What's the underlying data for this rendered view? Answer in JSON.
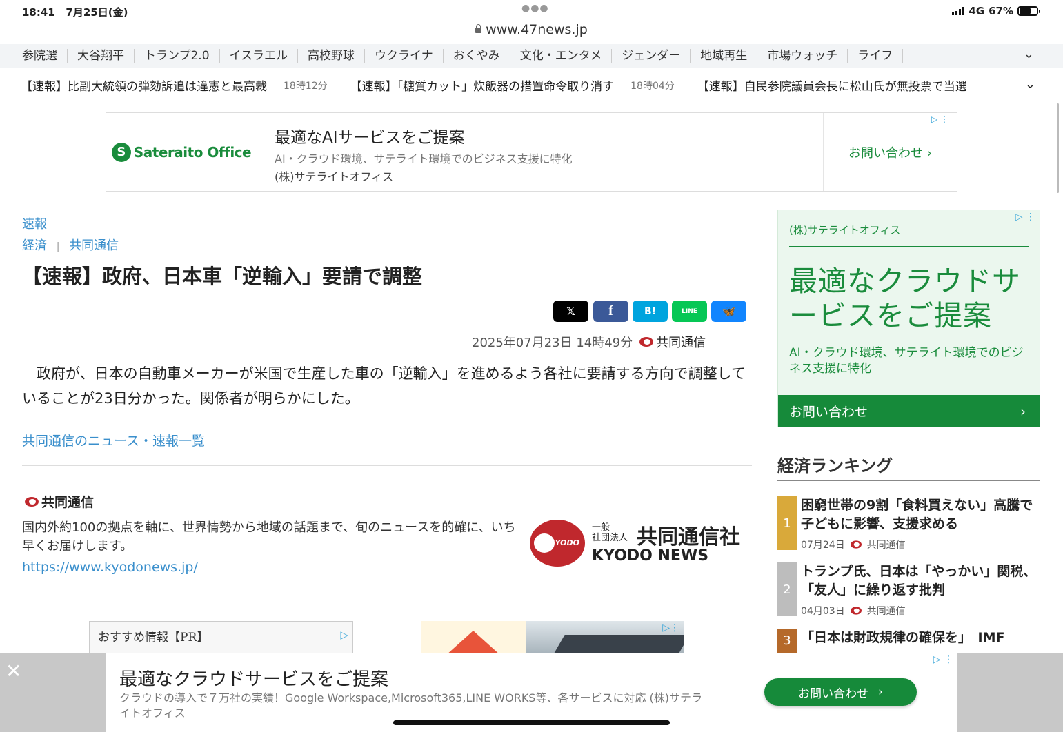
{
  "status": {
    "time": "18:41",
    "date": "7月25日(金)",
    "network": "4G",
    "battery": "67%",
    "battery_level": 0.67
  },
  "browser": {
    "url": "www.47news.jp"
  },
  "nav": {
    "categories": [
      "参院選",
      "大谷翔平",
      "トランプ2.0",
      "イスラエル",
      "高校野球",
      "ウクライナ",
      "おくやみ",
      "文化・エンタメ",
      "ジェンダー",
      "地域再生",
      "市場ウォッチ",
      "ライフ"
    ]
  },
  "ticker": [
    {
      "text": "【速報】比副大統領の弾劾訴追は違憲と最高裁",
      "time": "18時12分"
    },
    {
      "text": "【速報】「糖質カット」炊飯器の措置命令取り消す",
      "time": "18時04分"
    },
    {
      "text": "【速報】自民参院議員会長に松山氏が無投票で当選",
      "time": ""
    }
  ],
  "top_ad": {
    "logo_mark": "S",
    "logo_text": "Sateraito Office",
    "title": "最適なAIサービスをご提案",
    "description": "AI・クラウド環境、サテライト環境でのビジネス支援に特化",
    "advertiser": "(株)サテライトオフィス",
    "cta": "お問い合わせ ›"
  },
  "article": {
    "label": "速報",
    "category": "経済",
    "crumb_sep": "|",
    "source": "共同通信",
    "title": "【速報】政府、日本車「逆輸入」要請で調整",
    "share": {
      "x": "𝕏",
      "facebook": "f",
      "hatena": "B!",
      "line": "LINE",
      "bluesky": "🦋"
    },
    "datetime": "2025年07月23日 14時49分",
    "body": "　政府が、日本の自動車メーカーが米国で生産した車の「逆輸入」を進めるよう各社に要請する方向で調整していることが23日分かった。関係者が明らかにした。",
    "more_link": "共同通信のニュース・速報一覧"
  },
  "source_box": {
    "name": "共同通信",
    "description": "国内外約100の拠点を軸に、世界情勢から地域の話題まで、旬のニュースを的確に、いち早くお届けします。",
    "url": "https://www.kyodonews.jp/",
    "logo_small": "一般\n社団法人",
    "logo_jp": "共同通信社",
    "logo_en": "KYODO NEWS",
    "logo_mark": "KYODO"
  },
  "recommend": {
    "label": "おすすめ情報【PR】"
  },
  "side_ad": {
    "advertiser": "(株)サテライトオフィス",
    "headline": "最適なクラウドサービスをご提案",
    "sub": "AI・クラウド環境、サテライト環境でのビジネス支援に特化",
    "cta": "お問い合わせ",
    "cta_arrow": "›"
  },
  "ranking": {
    "title": "経済ランキング",
    "items": [
      {
        "rank": "1",
        "title": "困窮世帯の9割「食料買えない」高騰で子どもに影響、支援求める",
        "date": "07月24日",
        "source": "共同通信",
        "color": "#d9a93a"
      },
      {
        "rank": "2",
        "title": "トランプ氏、日本は「やっかい」関税、「友人」に繰り返す批判",
        "date": "04月03日",
        "source": "共同通信",
        "color": "#bdbdbd"
      },
      {
        "rank": "3",
        "title": "「日本は財政規律の確保を」　IMF",
        "date": "",
        "source": "",
        "color": "#b5692a"
      }
    ]
  },
  "sticky_ad": {
    "close": "✕",
    "title": "最適なクラウドサービスをご提案",
    "description": "クラウドの導入で７万社の実績！Google Workspace,Microsoft365,LINE WORKS等、各サービスに対応 (株)サテライトオフィス",
    "cta": "お問い合わせ",
    "cta_arrow": "›"
  },
  "colors": {
    "link": "#3a8fcc",
    "brand_green": "#168a3a",
    "kyodo_red": "#c0282d"
  }
}
